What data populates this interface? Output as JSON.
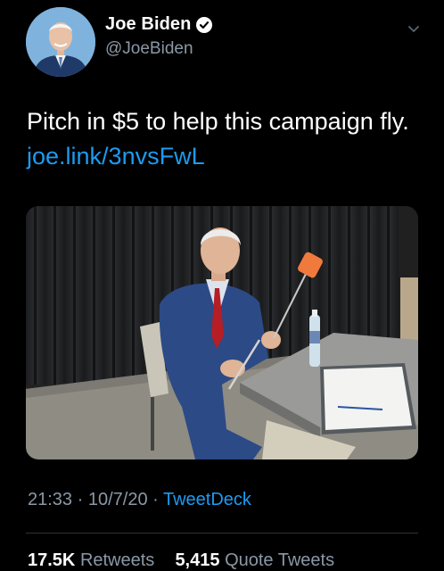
{
  "user": {
    "display_name": "Joe Biden",
    "handle": "@JoeBiden",
    "verified": true
  },
  "tweet": {
    "text_prefix": "Pitch in $5 to help this campaign fly.",
    "link_text": "joe.link/3nvsFwL"
  },
  "meta": {
    "time": "21:33",
    "date": "10/7/20",
    "source": "TweetDeck"
  },
  "stats": {
    "retweets_count": "17.5K",
    "retweets_label": "Retweets",
    "quotes_count": "5,415",
    "quotes_label": "Quote Tweets"
  },
  "icons": {
    "verified": "verified-badge-icon",
    "menu": "chevron-down-icon"
  },
  "colors": {
    "background": "#000000",
    "link": "#1d9bf0",
    "secondary_text": "#8b98a5"
  }
}
